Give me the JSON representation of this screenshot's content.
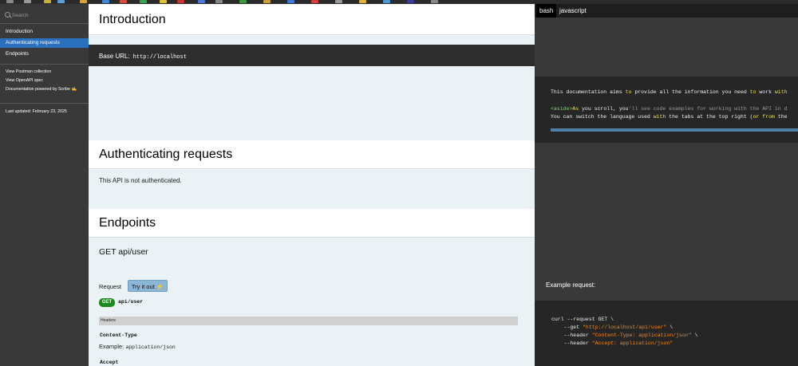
{
  "colors": {
    "accent": "#2a70bd",
    "badge_green": "#1a8a1a",
    "button": "#8cb6d6",
    "string": "#f08a24"
  },
  "sidebar": {
    "search_placeholder": "Search",
    "nav_items": [
      {
        "label": "Introduction",
        "active": false
      },
      {
        "label": "Authenticating requests",
        "active": true
      },
      {
        "label": "Endpoints",
        "active": false
      }
    ],
    "links": [
      {
        "label": "View Postman collection"
      },
      {
        "label": "View OpenAPI spec"
      },
      {
        "label": "Documentation powered by Scribe ✍"
      }
    ],
    "last_updated": "Last updated: February 23, 2025"
  },
  "main": {
    "intro_title": "Introduction",
    "base_url_label": "Base URL:",
    "base_url": "http://localhost",
    "auth_title": "Authenticating requests",
    "auth_text": "This API is not authenticated.",
    "endpoints_title": "Endpoints",
    "endpoint": {
      "title": "GET api/user",
      "request_label": "Request",
      "try_button": "Try it out",
      "method": "GET",
      "path": "api/user",
      "headers_label": "Headers",
      "fields": [
        {
          "name": "Content-Type",
          "example_label": "Example:",
          "example_value": "application/json"
        },
        {
          "name": "Accept"
        }
      ]
    }
  },
  "code_panel": {
    "tabs": [
      {
        "label": "bash",
        "active": true
      },
      {
        "label": "javascript",
        "active": false
      }
    ],
    "intro_code": {
      "line1": {
        "a": "This documentation aims ",
        "b": "to",
        "c": " provide all the information you need ",
        "d": "to",
        "e": " work ",
        "f": "with"
      },
      "line2": {
        "a": "<aside>",
        "b": "As",
        "c": " you scroll, you",
        "d": "'ll see code examples for working with the API in d"
      },
      "line3": {
        "a": "You can switch the language used ",
        "b": "with",
        "c": " the tabs at the top right (",
        "d": "or",
        "e": " ",
        "f": "from",
        "g": " the"
      }
    },
    "example_label": "Example request:",
    "curl": {
      "line1": "curl --request GET \\",
      "line2_pre": "    --get ",
      "line2_str": "\"http://localhost/api/user\"",
      "line2_post": " \\",
      "line3_pre": "    --header ",
      "line3_str": "\"Content-Type: application/json\"",
      "line3_post": " \\",
      "line4_pre": "    --header ",
      "line4_str": "\"Accept: application/json\""
    }
  }
}
